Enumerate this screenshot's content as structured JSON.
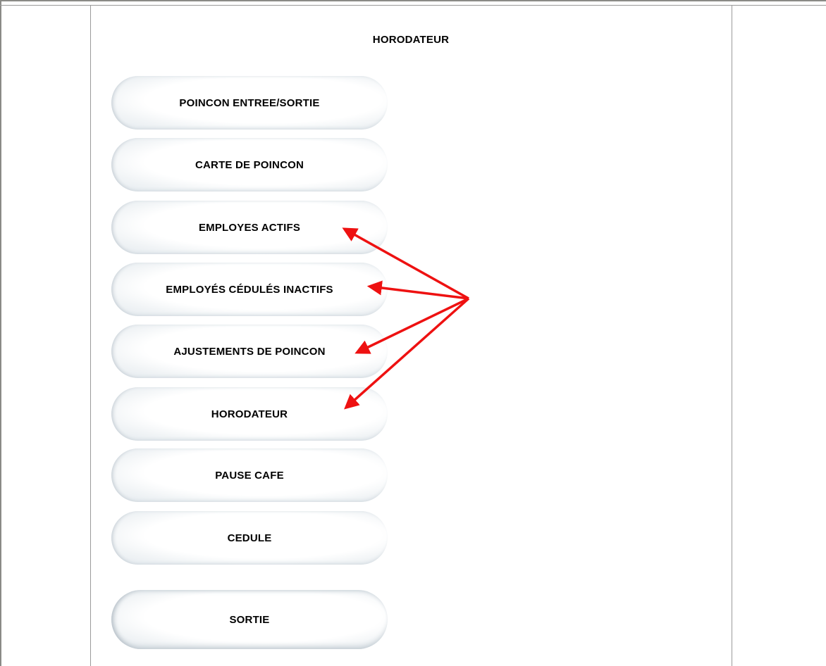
{
  "page": {
    "title": "HORODATEUR"
  },
  "menu": {
    "items": [
      {
        "label": "POINCON ENTREE/SORTIE"
      },
      {
        "label": "CARTE DE POINCON"
      },
      {
        "label": "EMPLOYES ACTIFS"
      },
      {
        "label": "EMPLOYÉS CÉDULÉS INACTIFS"
      },
      {
        "label": "AJUSTEMENTS DE POINCON"
      },
      {
        "label": "HORODATEUR"
      },
      {
        "label": "PAUSE CAFE"
      },
      {
        "label": "CEDULE"
      }
    ],
    "exit_label": "SORTIE"
  },
  "annotation": {
    "arrow_color": "#ee1111"
  }
}
